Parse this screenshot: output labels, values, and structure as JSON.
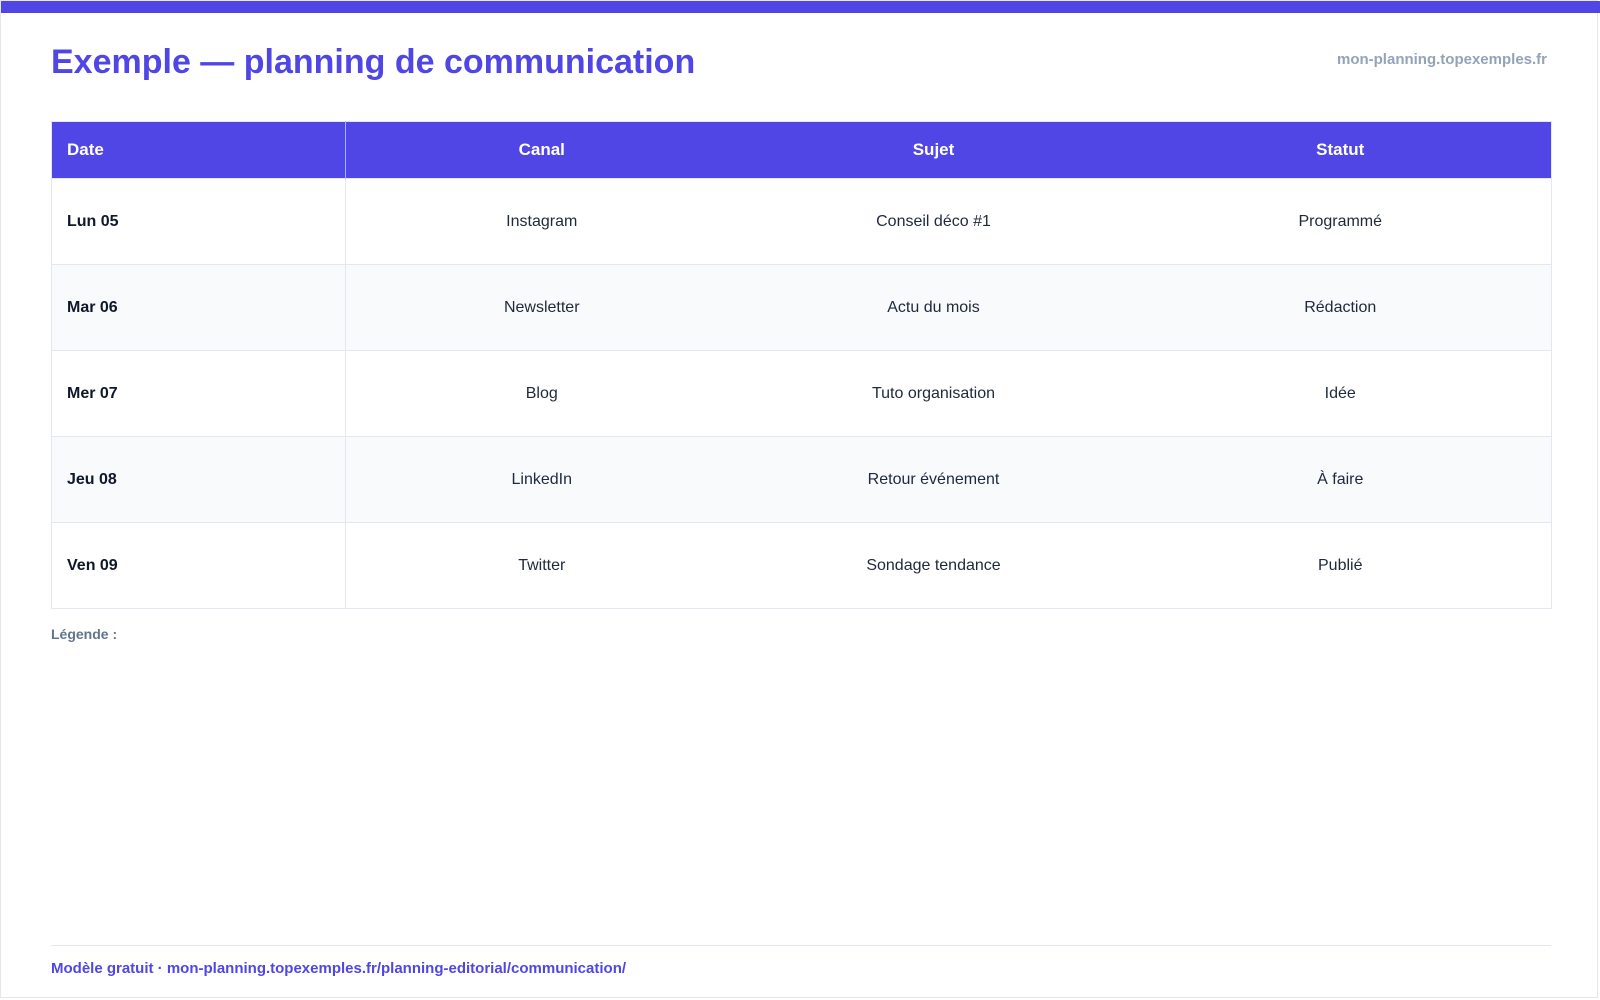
{
  "header": {
    "title": "Exemple — planning de communication",
    "site": "mon-planning.topexemples.fr"
  },
  "table": {
    "columns": [
      "Date",
      "Canal",
      "Sujet",
      "Statut"
    ],
    "rows": [
      [
        "Lun 05",
        "Instagram",
        "Conseil déco #1",
        "Programmé"
      ],
      [
        "Mar 06",
        "Newsletter",
        "Actu du mois",
        "Rédaction"
      ],
      [
        "Mer 07",
        "Blog",
        "Tuto organisation",
        "Idée"
      ],
      [
        "Jeu 08",
        "LinkedIn",
        "Retour événement",
        "À faire"
      ],
      [
        "Ven 09",
        "Twitter",
        "Sondage tendance",
        "Publié"
      ]
    ]
  },
  "legend": {
    "label": "Légende :"
  },
  "footer": {
    "text": "Modèle gratuit · mon-planning.topexemples.fr/planning-editorial/communication/"
  },
  "colors": {
    "accent": "#4f46e5",
    "muted": "#94a3b8",
    "row_alt": "#f8fafc"
  }
}
